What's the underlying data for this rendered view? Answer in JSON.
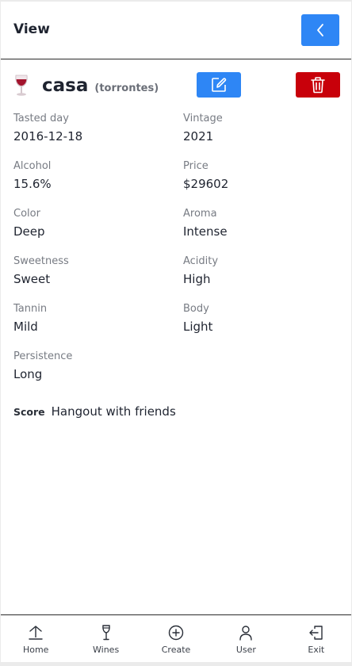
{
  "header": {
    "title": "View"
  },
  "wine": {
    "name": "casa",
    "variety": "(torrontes)"
  },
  "fields": [
    {
      "label": "Tasted day",
      "value": "2016-12-18"
    },
    {
      "label": "Vintage",
      "value": "2021"
    },
    {
      "label": "Alcohol",
      "value": "15.6%"
    },
    {
      "label": "Price",
      "value": "$29602"
    },
    {
      "label": "Color",
      "value": "Deep"
    },
    {
      "label": "Aroma",
      "value": "Intense"
    },
    {
      "label": "Sweetness",
      "value": "Sweet"
    },
    {
      "label": "Acidity",
      "value": "High"
    },
    {
      "label": "Tannin",
      "value": "Mild"
    },
    {
      "label": "Body",
      "value": "Light"
    },
    {
      "label": "Persistence",
      "value": "Long"
    }
  ],
  "score": {
    "label": "Score",
    "value": "Hangout with friends"
  },
  "nav": [
    {
      "label": "Home",
      "icon": "home-icon"
    },
    {
      "label": "Wines",
      "icon": "wine-glass-icon"
    },
    {
      "label": "Create",
      "icon": "plus-circle-icon"
    },
    {
      "label": "User",
      "icon": "user-icon"
    },
    {
      "label": "Exit",
      "icon": "exit-icon"
    }
  ],
  "colors": {
    "primary": "#2e86f5",
    "danger": "#c8000a",
    "text": "#1f2430",
    "muted": "#777b83"
  }
}
